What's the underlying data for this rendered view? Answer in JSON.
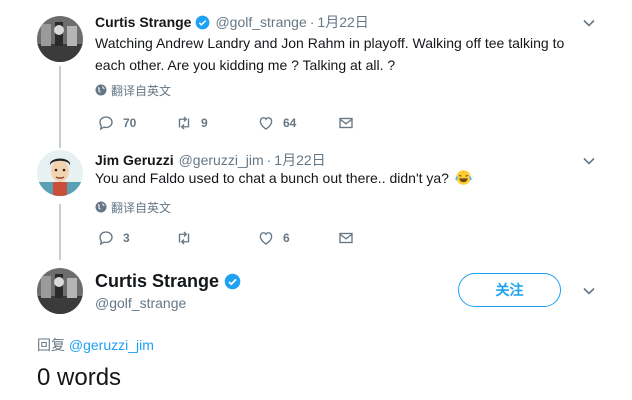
{
  "tweets": [
    {
      "name": "Curtis Strange",
      "verified": true,
      "handle": "@golf_strange",
      "dot": "·",
      "date": "1月22日",
      "text": "Watching Andrew Landry and Jon Rahm in playoff. Walking off tee talking to each other. Are you kidding me ? Talking at all. ?",
      "translate": "翻译自英文",
      "replies": "70",
      "retweets": "9",
      "likes": "64"
    },
    {
      "name": "Jim Geruzzi",
      "verified": false,
      "handle": "@geruzzi_jim",
      "dot": "·",
      "date": "1月22日",
      "text": "You and Faldo used to chat a bunch out there.. didn't ya?",
      "emoji": "face-with-tears-of-joy",
      "translate": "翻译自英文",
      "replies": "3",
      "retweets": "",
      "likes": "6"
    }
  ],
  "focused": {
    "name": "Curtis Strange",
    "verified": true,
    "handle": "@golf_strange",
    "follow_label": "关注"
  },
  "reply": {
    "prefix": "回复 ",
    "mention": "@geruzzi_jim"
  },
  "word_count": "0 words",
  "colors": {
    "accent": "#1da1f2",
    "secondary_text": "#657786",
    "thread_line": "#c4cfd6"
  }
}
